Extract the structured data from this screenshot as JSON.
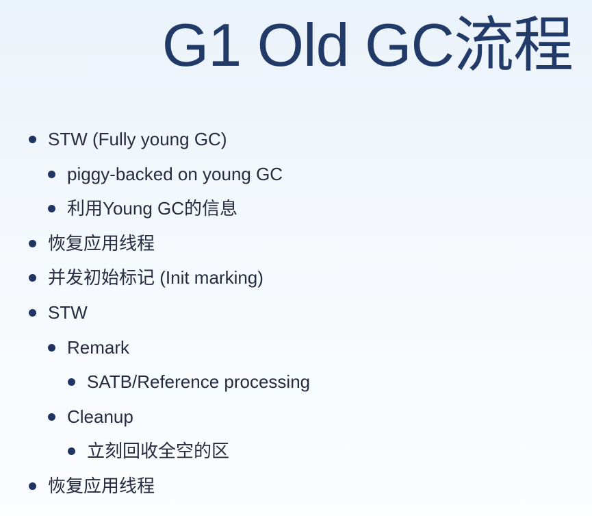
{
  "title": "G1 Old GC流程",
  "items": [
    {
      "text": "STW (Fully young GC)",
      "level": 0
    },
    {
      "text": "piggy-backed on young GC",
      "level": 1
    },
    {
      "text": "利用Young GC的信息",
      "level": 1
    },
    {
      "text": "恢复应用线程",
      "level": 0
    },
    {
      "text": "并发初始标记 (Init marking)",
      "level": 0
    },
    {
      "text": "STW",
      "level": 0
    },
    {
      "text": "Remark",
      "level": 1
    },
    {
      "text": "SATB/Reference processing",
      "level": 2
    },
    {
      "text": "Cleanup",
      "level": 1
    },
    {
      "text": "立刻回收全空的区",
      "level": 2
    },
    {
      "text": "恢复应用线程",
      "level": 0
    }
  ]
}
